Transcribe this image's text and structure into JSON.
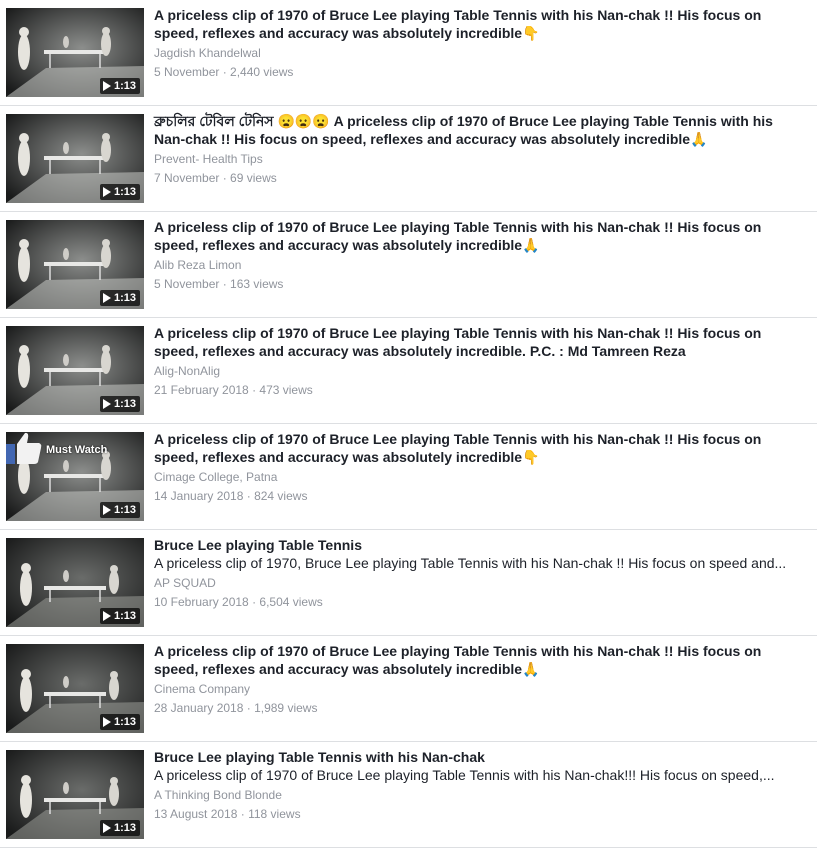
{
  "videos": [
    {
      "title": "A priceless clip of 1970 of Bruce Lee playing Table Tennis with his Nan-chak !! His focus on speed, reflexes and accuracy was absolutely incredible",
      "emoji": "👇",
      "description": "",
      "author": "Jagdish Khandelwal",
      "date": "5 November",
      "views": "2,440 views",
      "duration": "1:13",
      "overlay": ""
    },
    {
      "title": "ব্রুচলির টেবিল টেনিস 😦😦😦 A priceless clip of 1970 of Bruce Lee playing Table Tennis with his Nan-chak !! His focus on speed, reflexes and accuracy was absolutely incredible",
      "emoji": "🙏",
      "description": "",
      "author": "Prevent- Health Tips",
      "date": "7 November",
      "views": "69 views",
      "duration": "1:13",
      "overlay": ""
    },
    {
      "title": "A priceless clip of 1970 of Bruce Lee playing Table Tennis with his Nan-chak !! His focus on speed, reflexes and accuracy was absolutely incredible",
      "emoji": "🙏",
      "description": "",
      "author": "Alib Reza Limon",
      "date": "5 November",
      "views": "163 views",
      "duration": "1:13",
      "overlay": ""
    },
    {
      "title": "A priceless clip of 1970 of Bruce Lee playing Table Tennis with his Nan-chak !! His focus on speed, reflexes and accuracy was absolutely incredible. P.C. : Md Tamreen Reza",
      "emoji": "",
      "description": "",
      "author": "Alig-NonAlig",
      "date": "21 February 2018",
      "views": "473 views",
      "duration": "1:13",
      "overlay": ""
    },
    {
      "title": "A priceless clip of 1970 of Bruce Lee playing Table Tennis with his Nan-chak !! His focus on speed, reflexes and accuracy was absolutely incredible",
      "emoji": "👇",
      "description": "",
      "author": "Cimage College, Patna",
      "date": "14 January 2018",
      "views": "824 views",
      "duration": "1:13",
      "overlay": "Must Watch"
    },
    {
      "title": "Bruce Lee playing Table Tennis",
      "emoji": "",
      "description": "A priceless clip of 1970, Bruce Lee playing Table Tennis with his Nan-chak !! His focus on speed and...",
      "author": "AP SQUAD",
      "date": "10 February 2018",
      "views": "6,504 views",
      "duration": "1:13",
      "overlay": ""
    },
    {
      "title": "A priceless clip of 1970 of Bruce Lee playing Table Tennis with his Nan-chak !! His focus on speed, reflexes and accuracy was absolutely incredible",
      "emoji": "🙏",
      "description": "",
      "author": "Cinema Company",
      "date": "28 January 2018",
      "views": "1,989 views",
      "duration": "1:13",
      "overlay": ""
    },
    {
      "title": "Bruce Lee playing Table Tennis with his Nan-chak",
      "emoji": "",
      "description": "A priceless clip of 1970 of Bruce Lee playing Table Tennis with his Nan-chak!!! His focus on speed,...",
      "author": "A Thinking Bond Blonde",
      "date": "13 August 2018",
      "views": "118 views",
      "duration": "1:13",
      "overlay": ""
    }
  ],
  "separator": " · ",
  "colors": {
    "title": "#1d2129",
    "meta": "#90949c",
    "divider": "#dddfe2"
  }
}
